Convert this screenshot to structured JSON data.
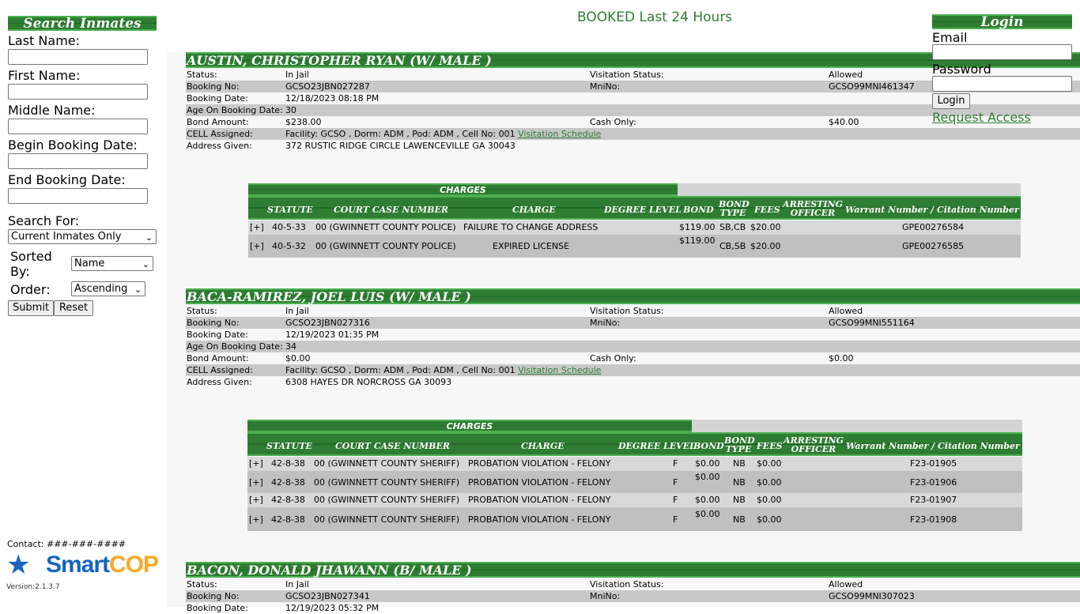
{
  "sidebar": {
    "title": "Search Inmates",
    "last_name_label": "Last Name:",
    "first_name_label": "First Name:",
    "middle_name_label": "Middle Name:",
    "begin_date_label": "Begin Booking Date:",
    "end_date_label": "End Booking Date:",
    "search_for_label": "Search For:",
    "search_for_value": "Current Inmates Only",
    "sorted_by_label": "Sorted By:",
    "sorted_by_value": "Name",
    "order_label": "Order:",
    "order_value": "Ascending",
    "submit_label": "Submit",
    "reset_label": "Reset",
    "contact": "Contact: ###-###-####",
    "logo_text": "SmartCOP",
    "version": "Version:2.1.3.7"
  },
  "page_title": "BOOKED Last 24 Hours",
  "login": {
    "title": "Login",
    "email_label": "Email",
    "password_label": "Password",
    "login_button": "Login",
    "request_access": "Request Access"
  },
  "detail_labels": {
    "status": "Status:",
    "visitation_status": "Visitation Status:",
    "booking_no": "Booking No:",
    "mnino": "MniNo:",
    "booking_date": "Booking Date:",
    "age": "Age On Booking Date:",
    "bond_amount": "Bond Amount:",
    "cash_only": "Cash Only:",
    "cell": "CELL Assigned:",
    "address": "Address Given:",
    "visitation_link": "Visitation Schedule"
  },
  "charge_headers": {
    "title": "CHARGES",
    "statute": "STATUTE",
    "court_case": "COURT CASE NUMBER",
    "charge": "CHARGE",
    "degree": "DEGREE LEVEL",
    "bond": "BOND",
    "bond_type_1": "BOND",
    "bond_type_2": "TYPE",
    "fees": "FEES",
    "officer_1": "ARRESTING",
    "officer_2": "OFFICER",
    "warrant": "Warrant Number / Citation Number"
  },
  "inmates": [
    {
      "name": "AUSTIN, CHRISTOPHER RYAN   (W/ MALE )",
      "status": "In Jail",
      "visitation": "Allowed",
      "booking_no": "GCSO23JBN027287",
      "mnino": "GCSO99MNI461347",
      "booking_date": "12/18/2023 08:18 PM",
      "age": "30",
      "bond": "$238.00",
      "cash_only": "$40.00",
      "cell": "Facility: GCSO , Dorm: ADM , Pod: ADM , Cell No: 001",
      "address": "372 RUSTIC RIDGE CIRCLE LAWENCEVILLE GA 30043",
      "charges": [
        {
          "expand": "[+]",
          "statute": "40-5-33",
          "case": "00 (GWINNETT COUNTY POLICE)",
          "charge": "FAILURE TO CHANGE ADDRESS",
          "degree": "",
          "bond": "$119.00",
          "type": "SB,CB",
          "fees": "$20.00",
          "warrant": "GPE00276584"
        },
        {
          "expand": "[+]",
          "statute": "40-5-32",
          "case": "00 (GWINNETT COUNTY POLICE)",
          "charge": "EXPIRED LICENSE",
          "degree": "",
          "bond": "$119.00",
          "type": "CB,SB",
          "fees": "$20.00",
          "warrant": "GPE00276585"
        }
      ]
    },
    {
      "name": "BACA-RAMIREZ, JOEL LUIS   (W/ MALE )",
      "status": "In Jail",
      "visitation": "Allowed",
      "booking_no": "GCSO23JBN027316",
      "mnino": "GCSO99MNI551164",
      "booking_date": "12/19/2023 01:35 PM",
      "age": "34",
      "bond": "$0.00",
      "cash_only": "$0.00",
      "cell": "Facility: GCSO , Dorm: ADM , Pod: ADM , Cell No: 001",
      "address": "6308 HAYES DR NORCROSS GA 30093",
      "charges": [
        {
          "expand": "[+]",
          "statute": "42-8-38",
          "case": "00 (GWINNETT COUNTY SHERIFF)",
          "charge": "PROBATION VIOLATION - FELONY",
          "degree": "F",
          "bond": "$0.00",
          "type": "NB",
          "fees": "$0.00",
          "warrant": "F23-01905"
        },
        {
          "expand": "[+]",
          "statute": "42-8-38",
          "case": "00 (GWINNETT COUNTY SHERIFF)",
          "charge": "PROBATION VIOLATION - FELONY",
          "degree": "F",
          "bond": "$0.00",
          "type": "NB",
          "fees": "$0.00",
          "warrant": "F23-01906"
        },
        {
          "expand": "[+]",
          "statute": "42-8-38",
          "case": "00 (GWINNETT COUNTY SHERIFF)",
          "charge": "PROBATION VIOLATION - FELONY",
          "degree": "F",
          "bond": "$0.00",
          "type": "NB",
          "fees": "$0.00",
          "warrant": "F23-01907"
        },
        {
          "expand": "[+]",
          "statute": "42-8-38",
          "case": "00 (GWINNETT COUNTY SHERIFF)",
          "charge": "PROBATION VIOLATION - FELONY",
          "degree": "F",
          "bond": "$0.00",
          "type": "NB",
          "fees": "$0.00",
          "warrant": "F23-01908"
        }
      ]
    },
    {
      "name": "BACON, DONALD JHAWANN   (B/ MALE )",
      "status": "In Jail",
      "visitation": "Allowed",
      "booking_no": "GCSO23JBN027341",
      "mnino": "GCSO99MNI307023",
      "booking_date": "12/19/2023 05:32 PM"
    }
  ]
}
